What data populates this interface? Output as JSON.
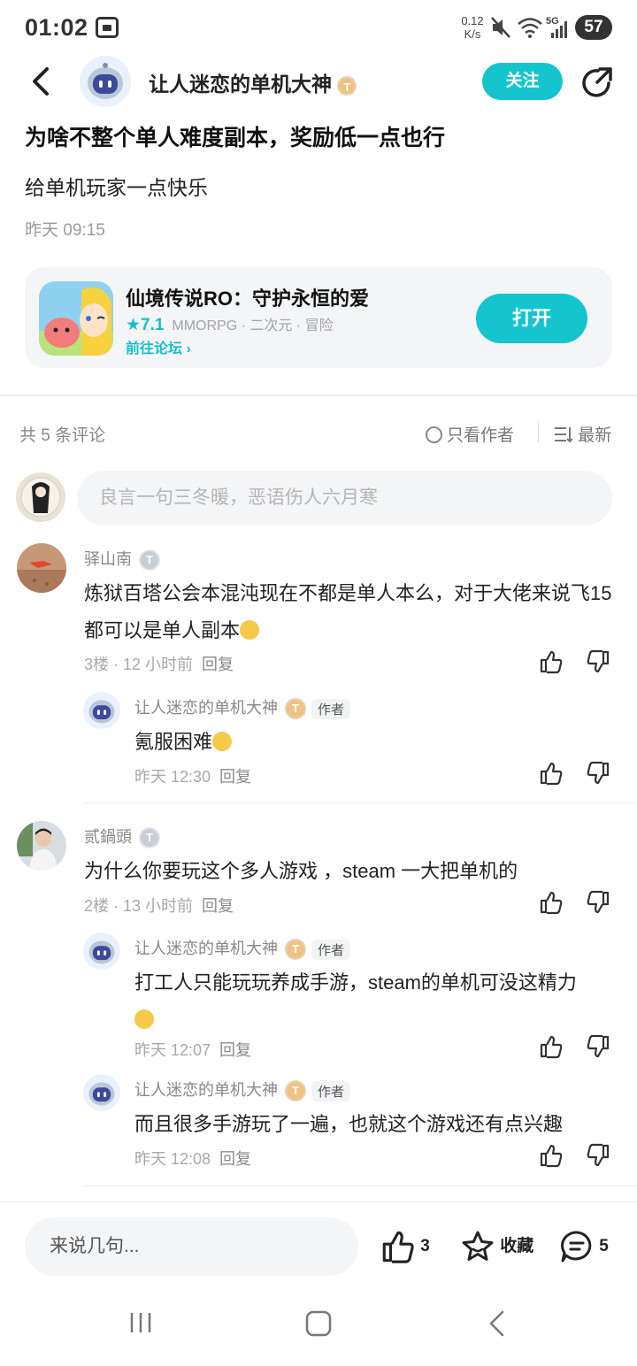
{
  "status_bar": {
    "time": "01:02",
    "net_speed_value": "0.12",
    "net_speed_unit": "K/s",
    "battery": "57",
    "network": "5G"
  },
  "header": {
    "author_name": "让人迷恋的单机大神",
    "author_level": "T",
    "follow_label": "关注"
  },
  "post": {
    "title": "为啥不整个单人难度副本，奖励低一点也行",
    "body": "给单机玩家一点快乐",
    "time": "昨天 09:15"
  },
  "game_card": {
    "name": "仙境传说RO：守护永恒的爱",
    "score": "7.1",
    "tags": "MMORPG · 二次元 · 冒险",
    "forum_link": "前往论坛",
    "open_label": "打开"
  },
  "comments_bar": {
    "count_label": "共 5 条评论",
    "only_author_label": "只看作者",
    "sort_label": "最新"
  },
  "comment_input_placeholder": "良言一句三冬暖，恶语伤人六月寒",
  "comments": [
    {
      "user": "驿山南",
      "level": "T",
      "text": "炼狱百塔公会本混沌现在不都是单人本么，对于大佬来说飞15都可以是单人副本",
      "meta": "3楼 · 12 小时前",
      "reply_label": "回复",
      "replies": [
        {
          "user": "让人迷恋的单机大神",
          "level": "T",
          "tag": "作者",
          "text": "氪服困难",
          "meta": "昨天 12:30",
          "reply_label": "回复"
        }
      ]
    },
    {
      "user": "贰鍋頭",
      "level": "T",
      "text": "为什么你要玩这个多人游戏 ，steam 一大把单机的",
      "meta": "2楼 · 13 小时前",
      "reply_label": "回复",
      "replies": [
        {
          "user": "让人迷恋的单机大神",
          "level": "T",
          "tag": "作者",
          "text": "打工人只能玩玩养成手游，steam的单机可没这精力",
          "meta": "昨天 12:07",
          "reply_label": "回复"
        },
        {
          "user": "让人迷恋的单机大神",
          "level": "T",
          "tag": "作者",
          "text": "而且很多手游玩了一遍，也就这个游戏还有点兴趣",
          "meta": "昨天 12:08",
          "reply_label": "回复"
        }
      ]
    }
  ],
  "bottom_bar": {
    "input_placeholder": "来说几句...",
    "like_count": "3",
    "collect_label": "收藏",
    "comment_count": "5"
  },
  "colors": {
    "accent": "#15c5ce",
    "text_primary": "#222222",
    "text_secondary": "#888888"
  }
}
